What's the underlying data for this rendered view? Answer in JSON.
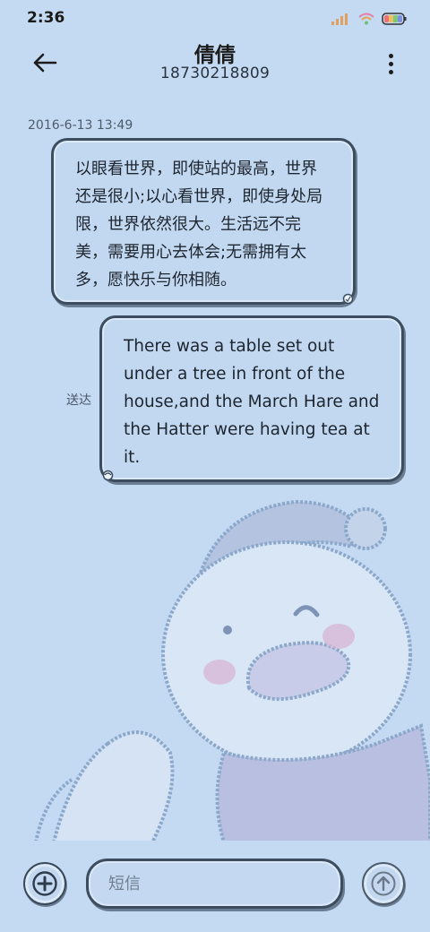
{
  "status_bar": {
    "time": "2:36",
    "icons": [
      "signal-icon",
      "wifi-icon",
      "battery-icon"
    ]
  },
  "header": {
    "contact_name": "倩倩",
    "contact_number": "18730218809",
    "back_icon": "arrow-left-icon",
    "more_icon": "more-vertical-icon"
  },
  "conversation": {
    "timestamp": "2016-6-13 13:49",
    "messages": [
      {
        "direction": "received",
        "text": "以眼看世界，即使站的最高，世界还是很小;以心看世界，即使身处局限，世界依然很大。生活远不完美，需要用心去体会;无需拥有太多，愿快乐与你相随。"
      },
      {
        "direction": "sent",
        "text": "There was a table set out under a tree in front of the house,and the March Hare and the Hatter were having tea at it.",
        "status": "送达"
      }
    ]
  },
  "composer": {
    "placeholder": "短信",
    "value": "",
    "add_icon": "plus-circle-icon",
    "send_icon": "arrow-up-icon"
  },
  "colors": {
    "background": "#c4daf2",
    "bubble_border": "#3c4d5f",
    "wallpaper_art": "#a9c2e2"
  }
}
